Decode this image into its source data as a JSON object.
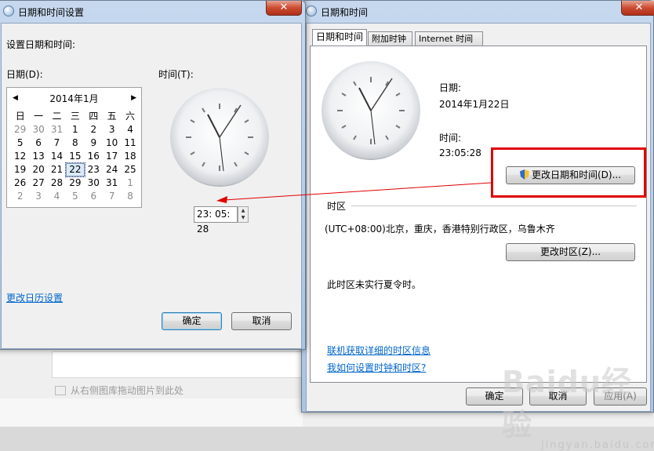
{
  "background": {
    "hint": "从右侧图库拖动图片到此处"
  },
  "left_dialog": {
    "title": "日期和时间设置",
    "close": "✕",
    "heading": "设置日期和时间:",
    "date_label": "日期(D):",
    "time_label": "时间(T):",
    "calendar": {
      "month": "2014年1月",
      "prev": "◀",
      "next": "▶",
      "weekdays": [
        "日",
        "一",
        "二",
        "三",
        "四",
        "五",
        "六"
      ],
      "weeks": [
        [
          {
            "d": "29",
            "g": true
          },
          {
            "d": "30",
            "g": true
          },
          {
            "d": "31",
            "g": true
          },
          {
            "d": "1"
          },
          {
            "d": "2"
          },
          {
            "d": "3"
          },
          {
            "d": "4"
          }
        ],
        [
          {
            "d": "5"
          },
          {
            "d": "6"
          },
          {
            "d": "7"
          },
          {
            "d": "8"
          },
          {
            "d": "9"
          },
          {
            "d": "10"
          },
          {
            "d": "11"
          }
        ],
        [
          {
            "d": "12"
          },
          {
            "d": "13"
          },
          {
            "d": "14"
          },
          {
            "d": "15"
          },
          {
            "d": "16"
          },
          {
            "d": "17"
          },
          {
            "d": "18"
          }
        ],
        [
          {
            "d": "19"
          },
          {
            "d": "20"
          },
          {
            "d": "21"
          },
          {
            "d": "22",
            "sel": true
          },
          {
            "d": "23"
          },
          {
            "d": "24"
          },
          {
            "d": "25"
          }
        ],
        [
          {
            "d": "26"
          },
          {
            "d": "27"
          },
          {
            "d": "28"
          },
          {
            "d": "29"
          },
          {
            "d": "30"
          },
          {
            "d": "31"
          },
          {
            "d": "1",
            "g": true
          }
        ],
        [
          {
            "d": "2",
            "g": true
          },
          {
            "d": "3",
            "g": true
          },
          {
            "d": "4",
            "g": true
          },
          {
            "d": "5",
            "g": true
          },
          {
            "d": "6",
            "g": true
          },
          {
            "d": "7",
            "g": true
          },
          {
            "d": "8",
            "g": true
          }
        ]
      ]
    },
    "time_value": "23: 05: 28",
    "calendar_settings_link": "更改日历设置",
    "ok": "确定",
    "cancel": "取消"
  },
  "right_dialog": {
    "title": "日期和时间",
    "tabs": [
      "日期和时间",
      "附加时钟",
      "Internet 时间"
    ],
    "date_label": "日期:",
    "date_value": "2014年1月22日",
    "time_label": "时间:",
    "time_value": "23:05:28",
    "change_datetime_button": "更改日期和时间(D)...",
    "timezone_header": "时区",
    "timezone_value": "(UTC+08:00)北京，重庆，香港特别行政区，乌鲁木齐",
    "change_timezone_button": "更改时区(Z)...",
    "dst_note": "此时区未实行夏令时。",
    "link_tz_info": "联机获取详细的时区信息",
    "link_how_set": "我如何设置时钟和时区?",
    "ok": "确定",
    "cancel": "取消",
    "apply": "应用(A)"
  },
  "colors": {
    "highlight_box": "#e00000",
    "arrow": "#e00000",
    "link": "#0066cc"
  },
  "watermark": {
    "text": "Baidu经验",
    "sub": "jingyan.baidu.com"
  }
}
